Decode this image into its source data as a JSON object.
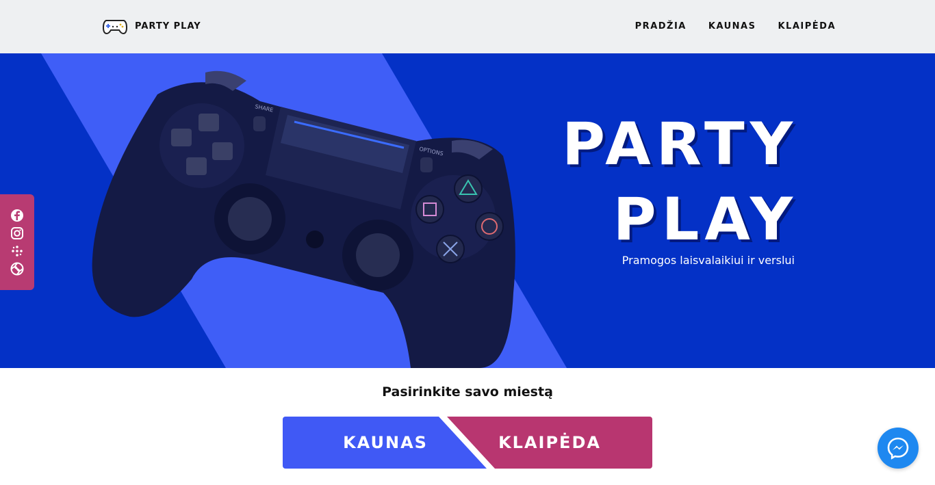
{
  "header": {
    "logo_text": "PARTY PLAY",
    "nav": [
      {
        "label": "PRADŽIA"
      },
      {
        "label": "KAUNAS"
      },
      {
        "label": "KLAIPĖDA"
      }
    ]
  },
  "hero": {
    "title_line1": "PARTY",
    "title_line2": "PLAY",
    "subtitle": "Pramogos laisvalaikiui ir verslui",
    "controller_labels": {
      "share": "SHARE",
      "options": "OPTIONS"
    }
  },
  "social": {
    "icons": [
      "facebook-icon",
      "instagram-icon",
      "dots-icon",
      "swirl-icon"
    ]
  },
  "city_select": {
    "prompt": "Pasirinkite savo miestą",
    "options": [
      {
        "label": "KAUNAS",
        "color": "#4059f5"
      },
      {
        "label": "KLAIPĖDA",
        "color": "#b83670"
      }
    ]
  },
  "colors": {
    "header_bg": "#eef0f2",
    "hero_bg": "#0431c6",
    "hero_stripe": "#3f5ef7",
    "social_bg": "#b83b72",
    "messenger": "#1e88f0"
  }
}
